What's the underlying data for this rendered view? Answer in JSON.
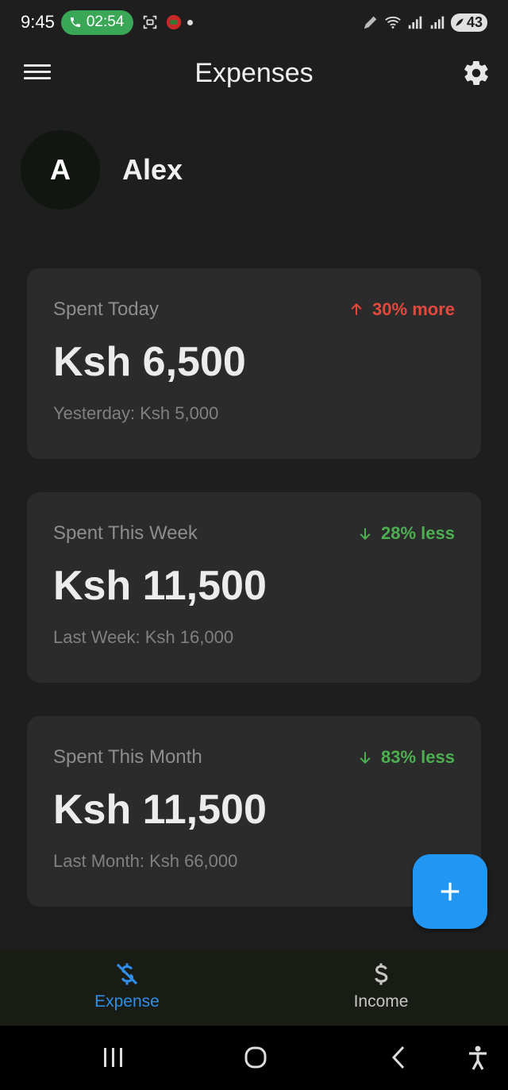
{
  "status_bar": {
    "time": "9:45",
    "call_duration": "02:54",
    "battery": "43",
    "icons": [
      "phone-icon",
      "screenshot-icon",
      "record-icon",
      "pen-icon",
      "wifi-icon",
      "signal-icon",
      "signal-icon",
      "battery-icon"
    ]
  },
  "app_bar": {
    "title": "Expenses",
    "menu_icon": "hamburger-menu-icon",
    "settings_icon": "gear-icon"
  },
  "profile": {
    "initial": "A",
    "name": "Alex"
  },
  "cards": [
    {
      "label": "Spent Today",
      "change": "30% more",
      "direction": "up",
      "amount": "Ksh 6,500",
      "compare": "Yesterday: Ksh 5,000"
    },
    {
      "label": "Spent This Week",
      "change": "28% less",
      "direction": "down",
      "amount": "Ksh 11,500",
      "compare": "Last Week: Ksh 16,000"
    },
    {
      "label": "Spent This Month",
      "change": "83% less",
      "direction": "down",
      "amount": "Ksh 11,500",
      "compare": "Last Month: Ksh 66,000"
    }
  ],
  "fab": {
    "icon": "plus-icon"
  },
  "bottom_nav": {
    "items": [
      {
        "label": "Expense",
        "icon": "money-off-icon",
        "active": true
      },
      {
        "label": "Income",
        "icon": "dollar-icon",
        "active": false
      }
    ]
  },
  "colors": {
    "background": "#1e1e1e",
    "card": "#2b2b2b",
    "increase": "#e4483d",
    "decrease": "#4caf50",
    "accent": "#2196f3",
    "nav_active": "#2f8ee8"
  }
}
